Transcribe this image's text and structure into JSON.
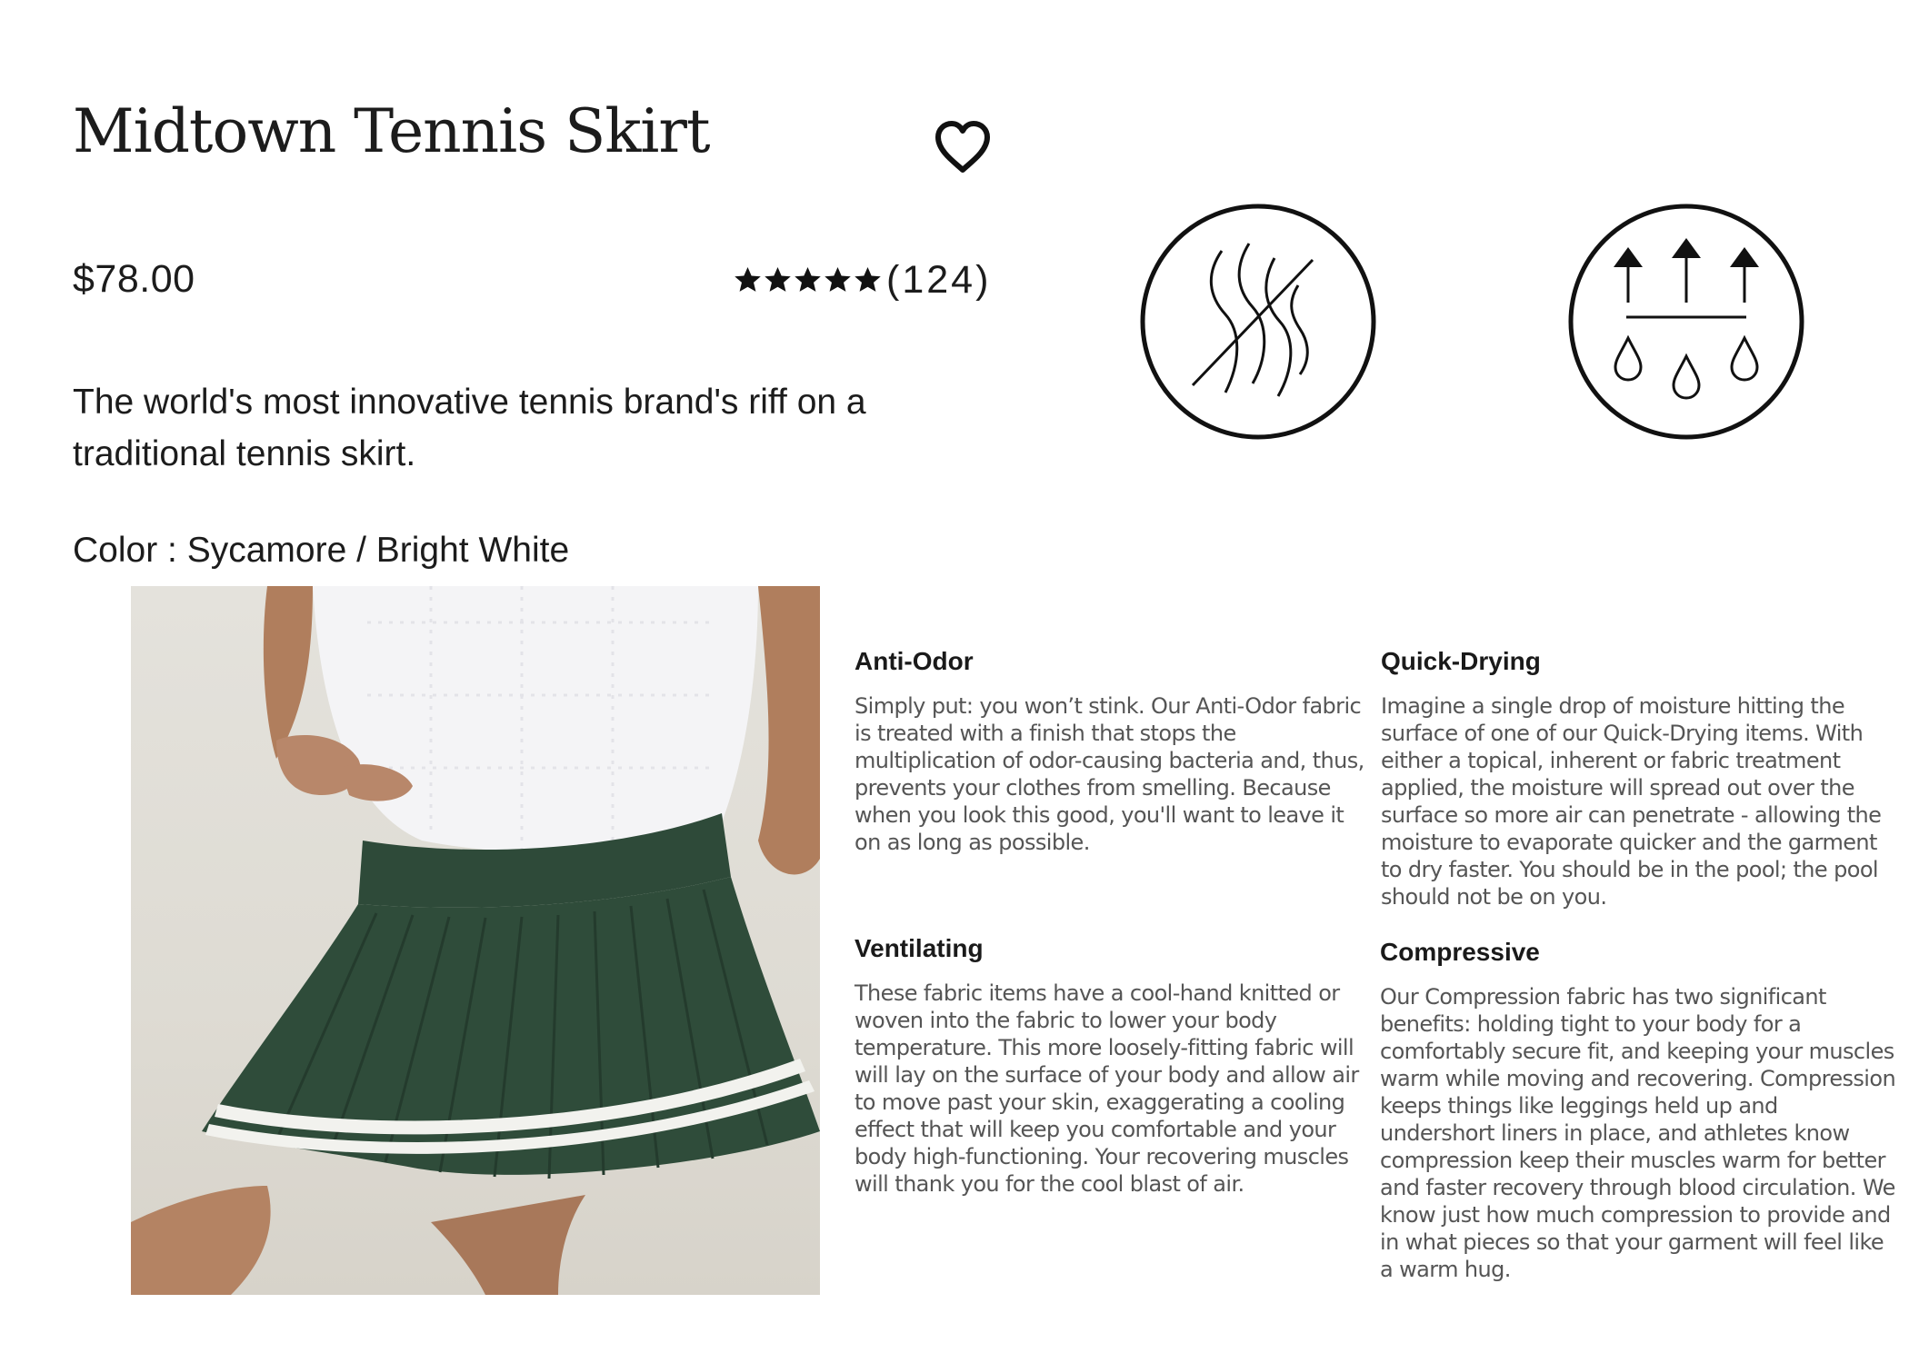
{
  "product": {
    "title": "Midtown Tennis Skirt",
    "price": "$78.00",
    "rating": {
      "stars": 5,
      "max_stars": 5,
      "count_text": "(124)"
    },
    "tagline": "The world's most innovative tennis brand's riff on a traditional tennis skirt.",
    "color_label": "Color : Sycamore / Bright White"
  },
  "icons": {
    "favorite": "heart-icon",
    "star": "star-icon",
    "anti_odor_badge": "anti-odor-icon",
    "quick_drying_badge": "quick-drying-icon"
  },
  "features": [
    {
      "title": "Anti-Odor",
      "body": "Simply put: you won’t stink. Our Anti-Odor fabric is treated with a finish that stops the multiplication of odor-causing bacteria and, thus, prevents your clothes from smelling. Because when you look this good, you'll want to leave it on as long as possible."
    },
    {
      "title": "Quick-Drying",
      "body": "Imagine a single drop of moisture hitting the surface of one of our Quick-Drying items. With either a topical, inherent or fabric treatment applied, the moisture will spread out over the surface so more air can penetrate - allowing the moisture to evaporate quicker and the garment to dry faster. You should be in the pool; the pool should not be on you."
    },
    {
      "title": "Ventilating",
      "body": "These fabric items have a cool-hand knitted or woven into the fabric to lower your body temperature. This more loosely-fitting fabric will will lay on the surface of your body and allow air to move past your skin, exaggerating a cooling effect that will keep you comfortable and your body high-functioning. Your recovering muscles will thank you for the cool blast of air."
    },
    {
      "title": "Compressive",
      "body": "Our Compression fabric has two significant benefits: holding tight to your body for a comfortably secure fit, and keeping your muscles warm while moving and recovering. Compression keeps things like leggings held up and undershort liners in place, and athletes know compression keep their muscles warm for better and faster recovery through blood circulation. We know just how much compression to provide and in what pieces so that your garment will feel like a warm hug."
    }
  ],
  "colors": {
    "skirt_green": "#2f4c3a",
    "stripe_white": "#f2f2ee",
    "photo_background": "#e0ddd6",
    "text_primary": "#1c1c1c",
    "text_secondary": "#555555"
  }
}
